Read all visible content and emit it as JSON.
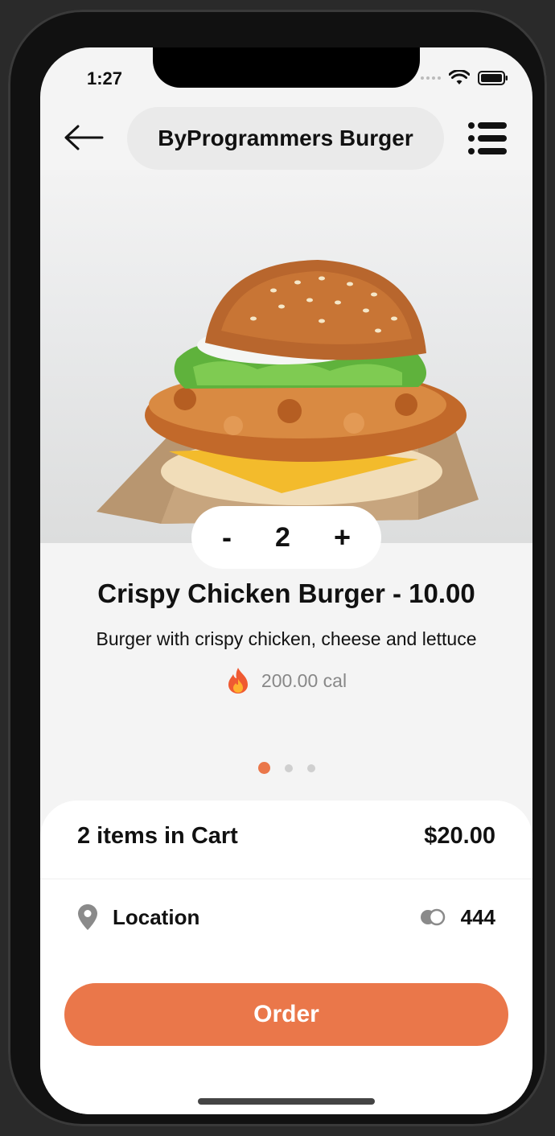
{
  "status_bar": {
    "time": "1:27"
  },
  "header": {
    "title": "ByProgrammers Burger",
    "back_icon": "arrow-left-icon",
    "menu_icon": "list-icon"
  },
  "product": {
    "image": "crispy-chicken-burger-image",
    "quantity": "2",
    "minus_label": "-",
    "plus_label": "+",
    "name": "Crispy Chicken Burger - 10.00",
    "description": "Burger with crispy chicken, cheese and lettuce",
    "calories": "200.00 cal",
    "calories_icon": "fire-icon"
  },
  "carousel": {
    "count": 3,
    "active_index": 0
  },
  "cart": {
    "summary": "2 items in Cart",
    "total": "$20.00",
    "location_label": "Location",
    "location_icon": "map-pin-icon",
    "card_icon": "card-toggle-icon",
    "card_value": "444",
    "order_label": "Order"
  },
  "colors": {
    "accent": "#EA774A",
    "background": "#F4F4F4",
    "sheet": "#FFFFFF",
    "text": "#111111",
    "muted": "#888888"
  }
}
